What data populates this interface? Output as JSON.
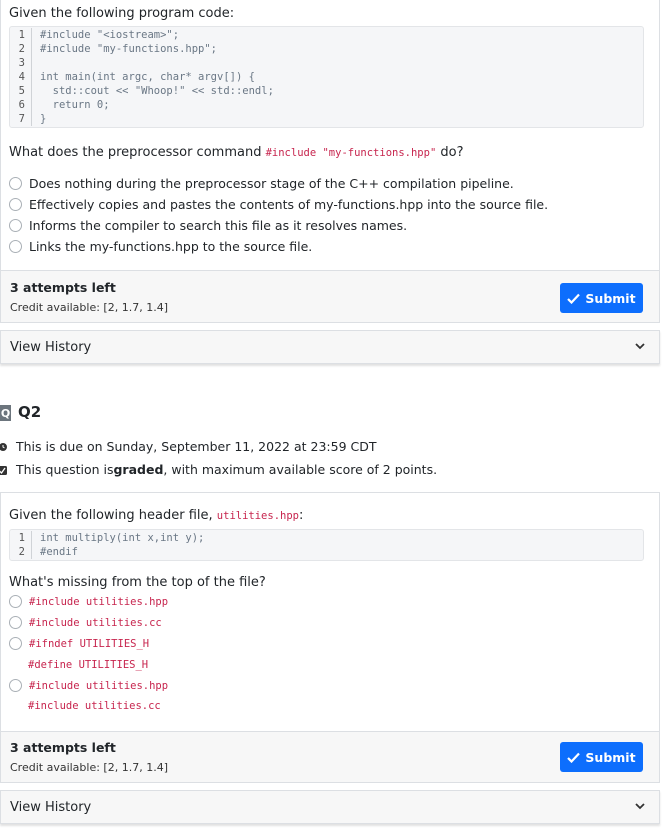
{
  "q1": {
    "intro": "Given the following program code:",
    "code_lines": [
      {
        "n": "1",
        "code": "#include \"<iostream>\";"
      },
      {
        "n": "2",
        "code": "#include \"my-functions.hpp\";"
      },
      {
        "n": "3",
        "code": ""
      },
      {
        "n": "4",
        "code": "int main(int argc, char* argv[]) {"
      },
      {
        "n": "5",
        "code": "  std::cout << \"Whoop!\" << std::endl;"
      },
      {
        "n": "6",
        "code": "  return 0;"
      },
      {
        "n": "7",
        "code": "}"
      }
    ],
    "question_before": "What does the preprocessor command ",
    "question_code": "#include \"my-functions.hpp\"",
    "question_after": " do?",
    "options": [
      "Does nothing during the preprocessor stage of the C++ compilation pipeline.",
      "Effectively copies and pastes the contents of my-functions.hpp into the source file.",
      "Informs the compiler to search this file as it resolves names.",
      "Links the my-functions.hpp to the source file."
    ],
    "attempts": "3 attempts left",
    "credit": "Credit available: [2, 1.7, 1.4]",
    "submit_label": "Submit",
    "history_label": "View History"
  },
  "q2": {
    "badge": "Q",
    "title": "Q2",
    "due": "This is due on Sunday, September 11, 2022 at 23:59 CDT",
    "graded_before": "This question is ",
    "graded_bold": "graded",
    "graded_after": ", with maximum available score of 2 points.",
    "intro_before": "Given the following header file, ",
    "intro_code": "utilities.hpp",
    "intro_after": ":",
    "code_lines": [
      {
        "n": "1",
        "code": "int multiply(int x,int y);"
      },
      {
        "n": "2",
        "code": "#endif"
      }
    ],
    "question": "What's missing from the top of the file?",
    "options": {
      "a": "#include utilities.hpp",
      "b": "#include utilities.cc",
      "c1": "#ifndef UTILITIES_H",
      "c2": "#define UTILITIES_H",
      "d1": "#include utilities.hpp",
      "d2": "#include utilities.cc"
    },
    "attempts": "3 attempts left",
    "credit": "Credit available: [2, 1.7, 1.4]",
    "submit_label": "Submit",
    "history_label": "View History"
  },
  "colors": {
    "accent": "#0d6efd",
    "code_pink": "#c7254e"
  }
}
